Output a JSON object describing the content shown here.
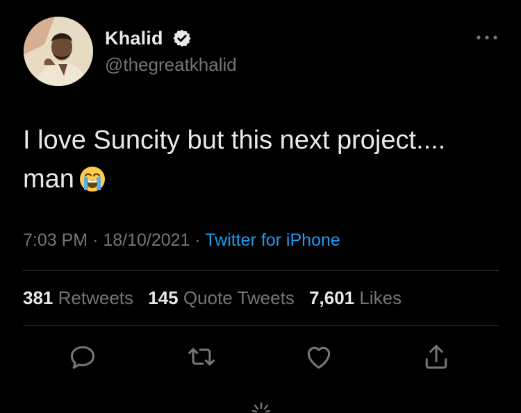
{
  "author": {
    "display_name": "Khalid",
    "handle": "@thegreatkhalid",
    "verified": true,
    "avatar_icon": "profile-photo"
  },
  "tweet": {
    "text": "I love Suncity but this next project.... man",
    "emoji": "loudly-crying-face",
    "time": "7:03 PM",
    "date": "18/10/2021",
    "separator": "·",
    "source": "Twitter for iPhone"
  },
  "stats": {
    "retweets_count": "381",
    "retweets_label": "Retweets",
    "quotes_count": "145",
    "quotes_label": "Quote Tweets",
    "likes_count": "7,601",
    "likes_label": "Likes"
  },
  "actions": [
    "reply-icon",
    "retweet-icon",
    "like-icon",
    "share-icon"
  ],
  "colors": {
    "background": "#000000",
    "text": "#e7e9ea",
    "muted": "#71767b",
    "link": "#1d9bf0",
    "divider": "#2f3336"
  }
}
